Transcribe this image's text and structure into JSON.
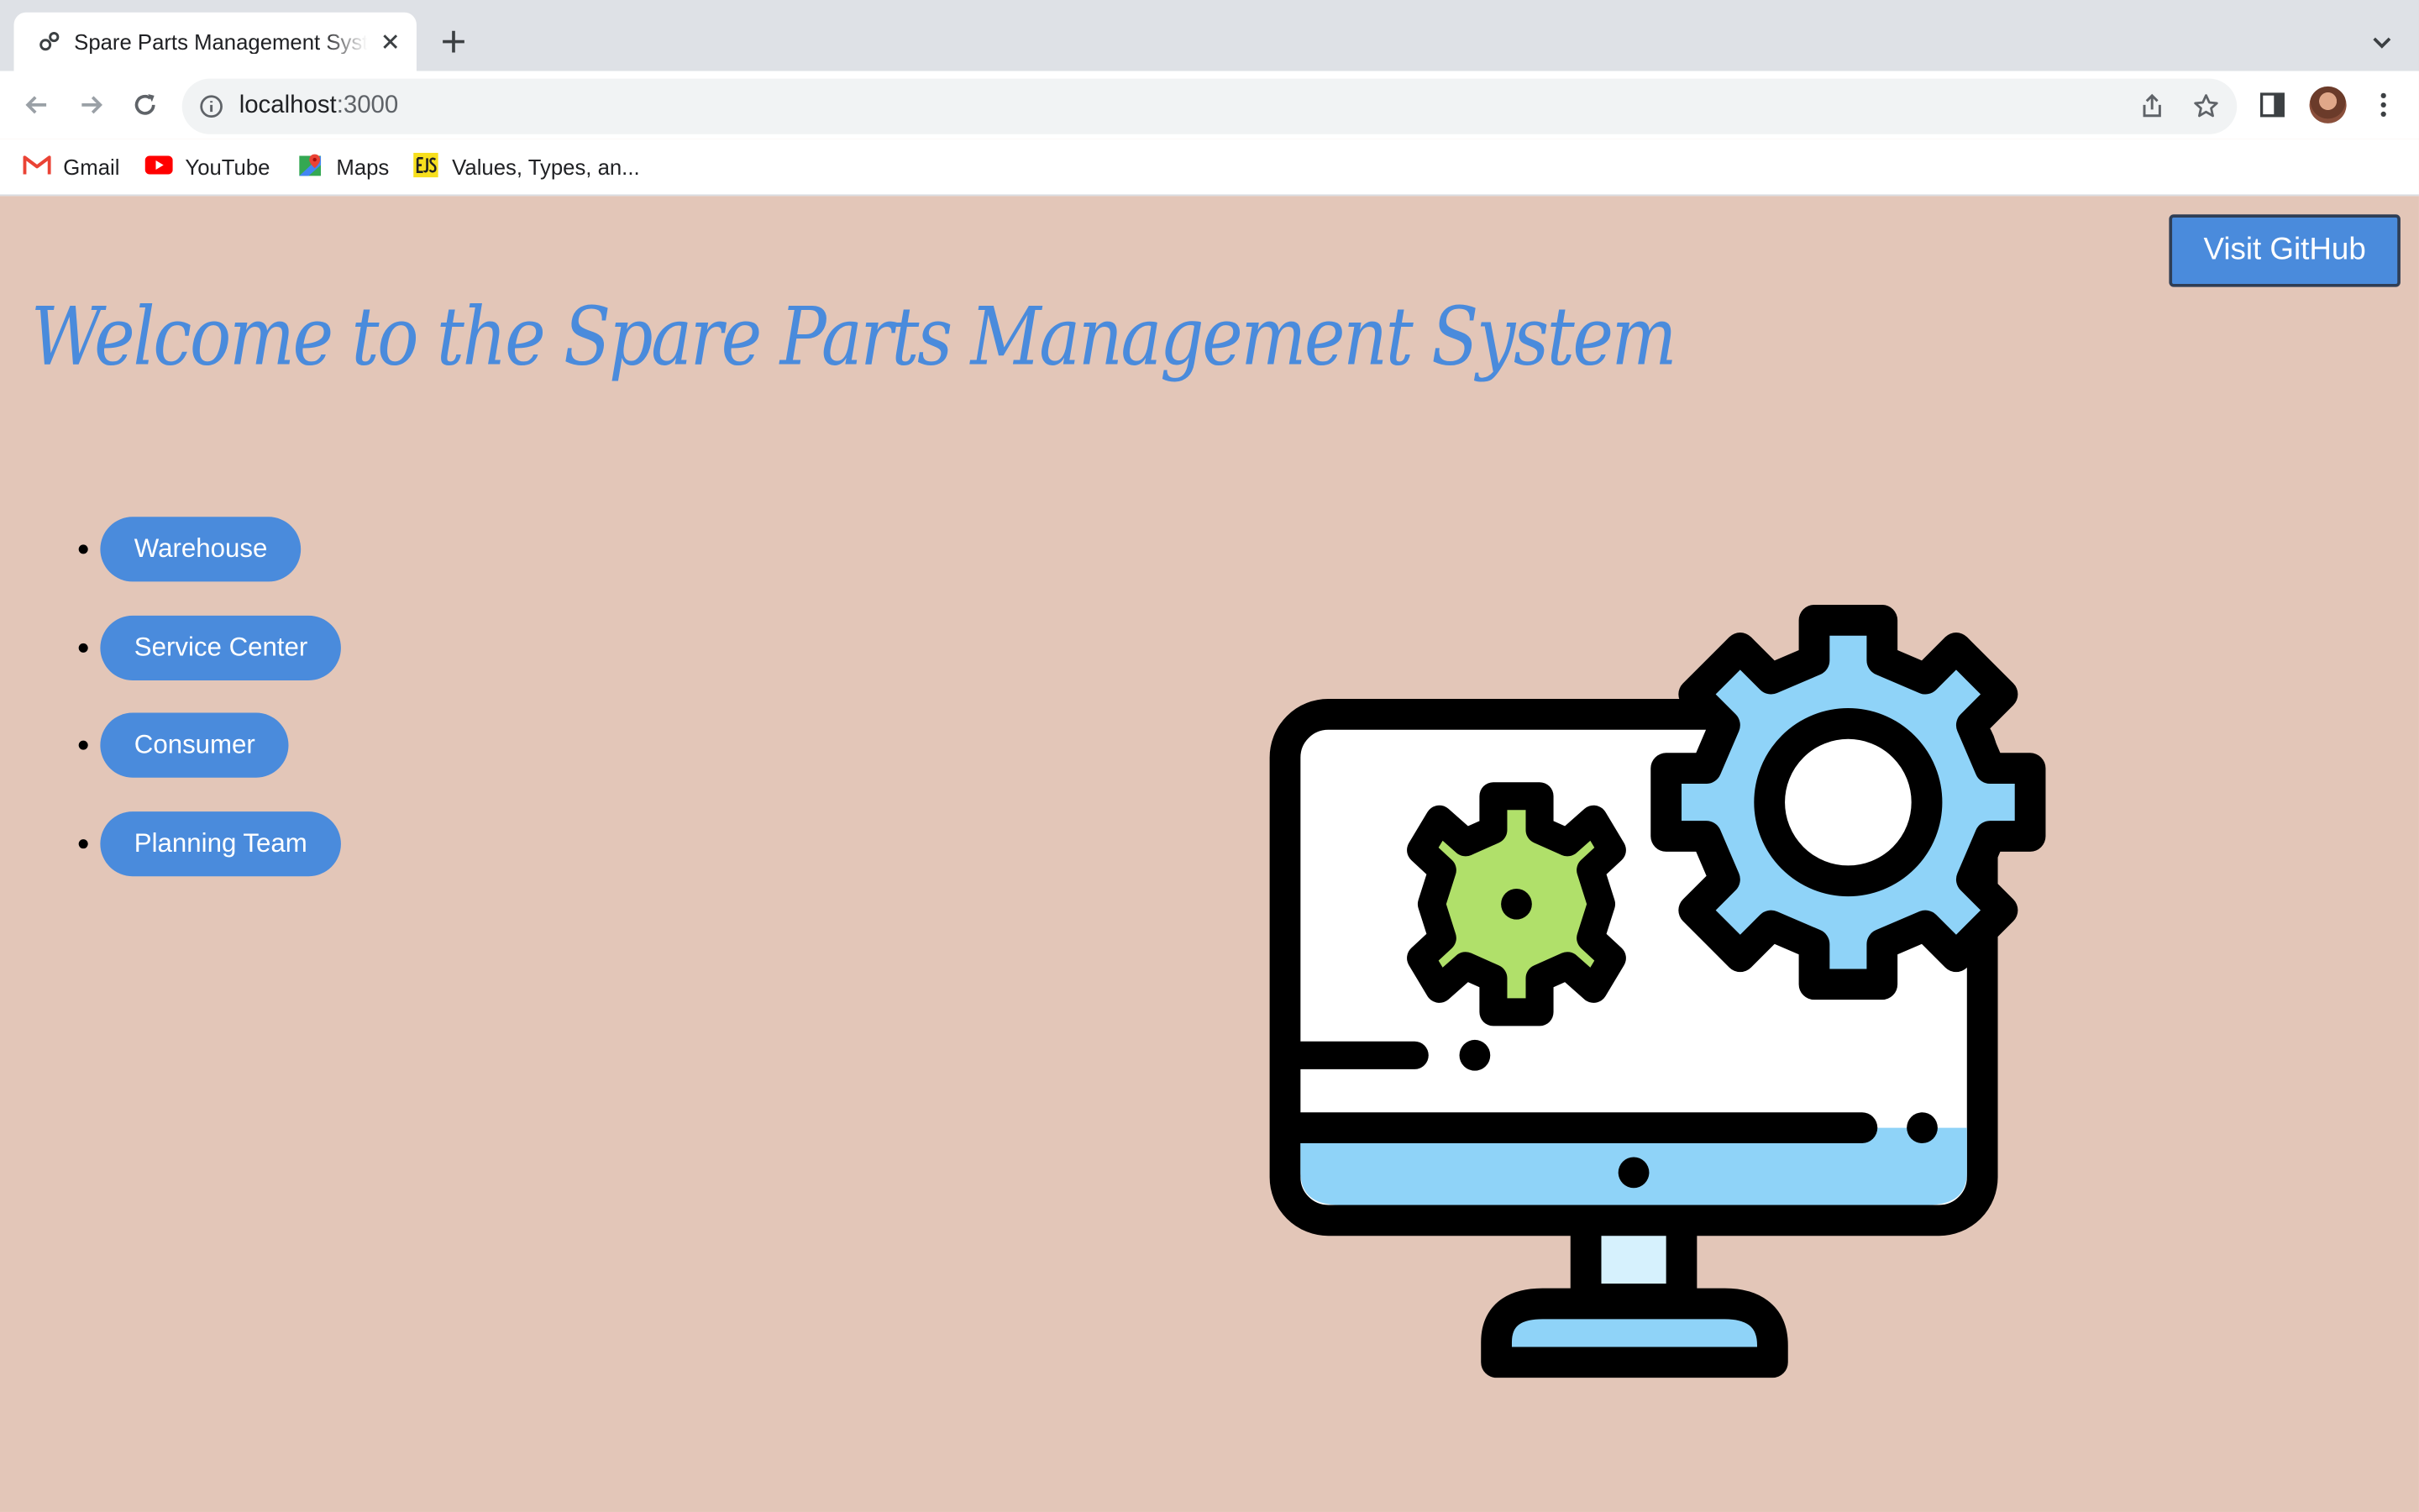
{
  "browser": {
    "tab_title": "Spare Parts Management System",
    "url_host": "localhost",
    "url_port": ":3000",
    "bookmarks": [
      {
        "label": "Gmail",
        "icon": "gmail-icon"
      },
      {
        "label": "YouTube",
        "icon": "youtube-icon"
      },
      {
        "label": "Maps",
        "icon": "maps-icon"
      },
      {
        "label": "Values, Types, an...",
        "icon": "ejs-icon"
      }
    ]
  },
  "page": {
    "github_button": "Visit GitHub",
    "heading": "Welcome to the Spare Parts Management System",
    "nav_items": [
      "Warehouse",
      "Service Center",
      "Consumer",
      "Planning Team"
    ],
    "illustration": "monitor-with-gears-icon"
  },
  "colors": {
    "background": "#e3c6b8",
    "accent": "#4a8bdc",
    "gear_large": "#8fd3f8",
    "gear_small": "#b0e06a"
  }
}
